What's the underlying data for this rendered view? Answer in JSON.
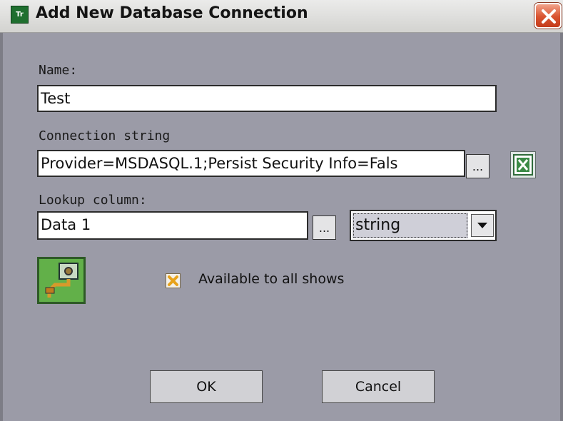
{
  "window": {
    "title": "Add New Database Connection",
    "app_icon_text": "Tr",
    "icons": {
      "app": "app-icon",
      "close": "close-icon"
    }
  },
  "form": {
    "name_label": "Name:",
    "name_value": "Test",
    "connection_label": "Connection string",
    "connection_value": "Provider=MSDASQL.1;Persist Security Info=Fals",
    "connection_browse_label": "...",
    "excel_icon": "excel-icon",
    "lookup_label": "Lookup column:",
    "lookup_value": "Data 1",
    "lookup_browse_label": "...",
    "type_selected": "string",
    "connect_icon": "plug-connect-icon",
    "available_label": "Available to all shows",
    "available_checked": true
  },
  "buttons": {
    "ok": "OK",
    "cancel": "Cancel"
  },
  "colors": {
    "dialog_bg": "#9b9ba7",
    "connect_green": "#62b049",
    "close_red": "#d9532f",
    "checkbox_mark": "#e8a21a"
  }
}
